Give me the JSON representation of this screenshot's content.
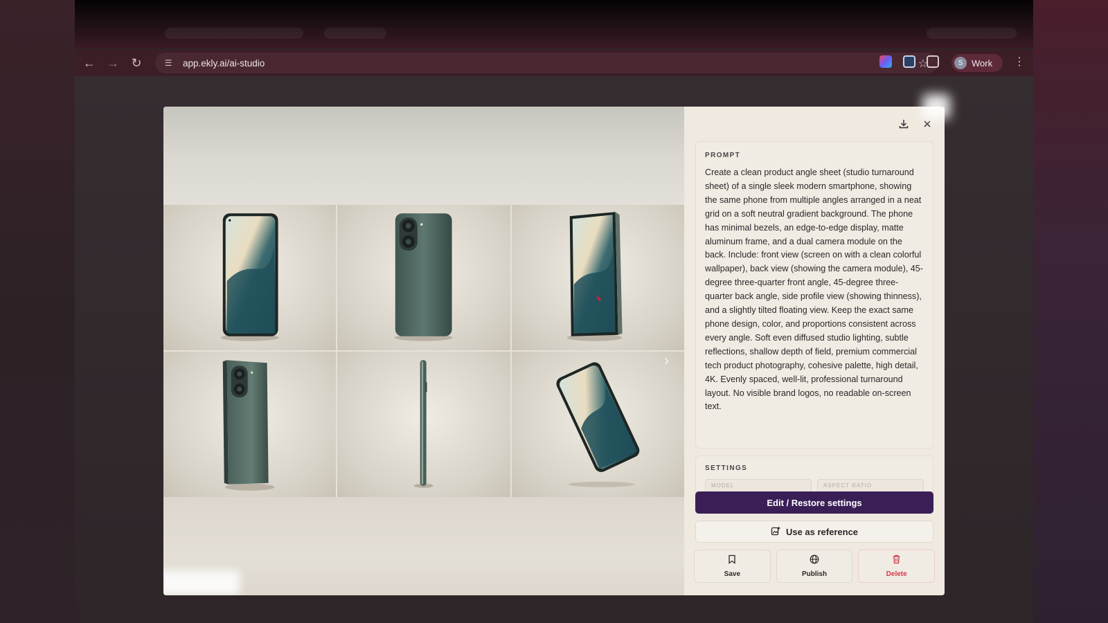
{
  "browser": {
    "url": "app.ekly.ai/ai-studio",
    "profile_initial": "S",
    "profile_label": "Work"
  },
  "modal": {
    "prompt_label": "PROMPT",
    "prompt_text": "Create a clean product angle sheet (studio turnaround sheet) of a single sleek modern smartphone, showing the same phone from multiple angles arranged in a neat grid on a soft neutral gradient background. The phone has minimal bezels, an edge-to-edge display, matte aluminum frame, and a dual camera module on the back. Include: front view (screen on with a clean colorful wallpaper), back view (showing the camera module), 45-degree three-quarter front angle, 45-degree three-quarter back angle, side profile view (showing thinness), and a slightly tilted floating view. Keep the exact same phone design, color, and proportions consistent across every angle. Soft even diffused studio lighting, subtle reflections, shallow depth of field, premium commercial tech product photography, cohesive palette, high detail, 4K. Evenly spaced, well-lit, professional turnaround layout. No visible brand logos, no readable on-screen text.",
    "settings_label": "SETTINGS",
    "settings_fields": [
      "MODEL",
      "ASPECT RATIO"
    ],
    "edit_restore_label": "Edit / Restore settings",
    "use_reference_label": "Use as reference",
    "actions": [
      {
        "label": "Save",
        "icon": "bookmark-icon"
      },
      {
        "label": "Publish",
        "icon": "globe-icon"
      },
      {
        "label": "Delete",
        "icon": "trash-icon"
      }
    ]
  },
  "colors": {
    "primary": "#3a1f57",
    "danger": "#d13a4a",
    "phone": "#4e6660",
    "wallpaper_teal": "#1f4f5a",
    "wallpaper_cream": "#e8d9bd"
  }
}
